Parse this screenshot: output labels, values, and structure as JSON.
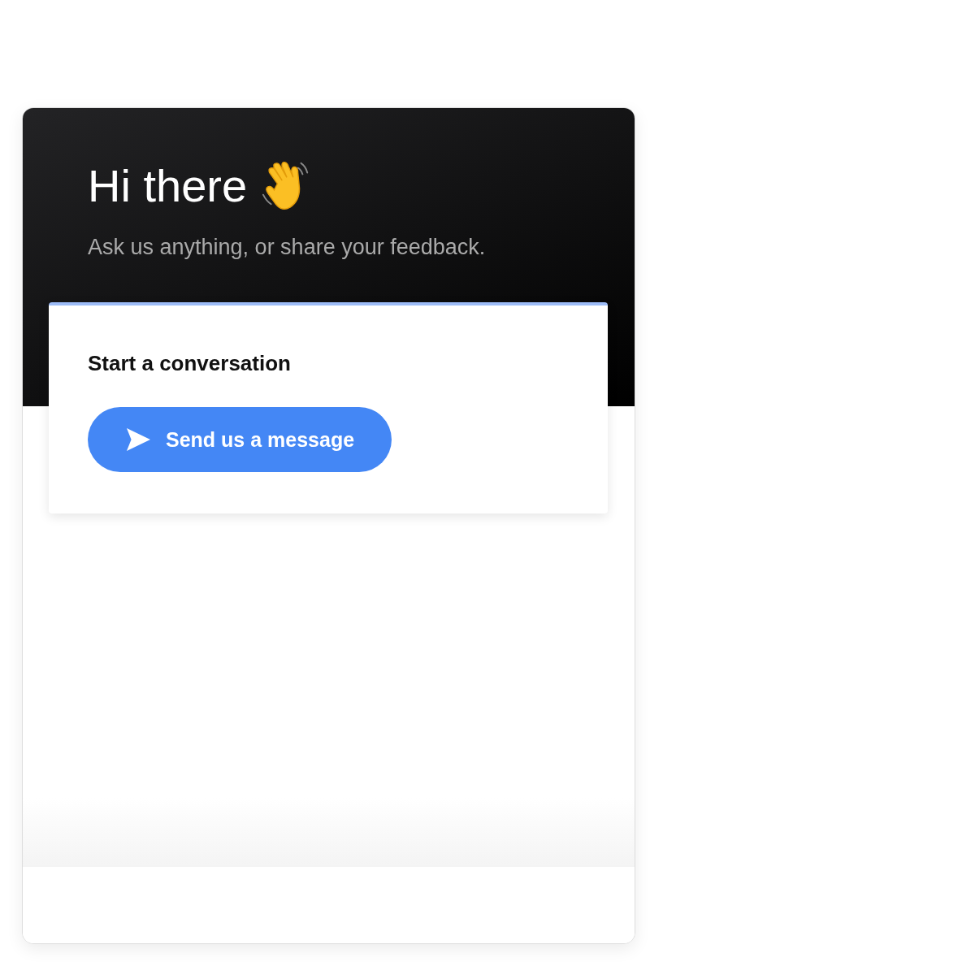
{
  "header": {
    "title": "Hi there",
    "subtitle": "Ask us anything, or share your feedback."
  },
  "card": {
    "title": "Start a conversation",
    "button": "Send us a message"
  }
}
